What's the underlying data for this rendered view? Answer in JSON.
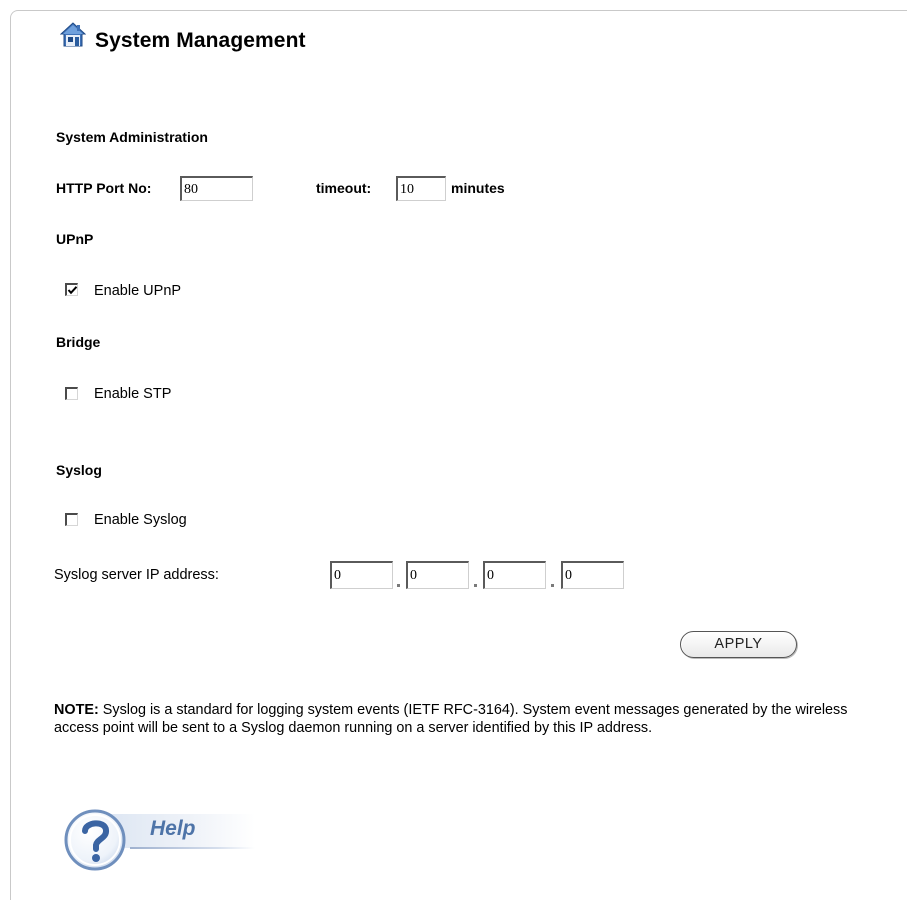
{
  "page": {
    "title": "System Management"
  },
  "sections": {
    "admin": "System Administration",
    "upnp": "UPnP",
    "bridge": "Bridge",
    "syslog": "Syslog"
  },
  "admin": {
    "http_port_label": "HTTP Port No:",
    "http_port_value": "80",
    "timeout_label": "timeout:",
    "timeout_value": "10",
    "timeout_unit": "minutes"
  },
  "upnp": {
    "enable_label": "Enable UPnP",
    "enabled": true
  },
  "bridge": {
    "stp_label": "Enable STP",
    "enabled": false
  },
  "syslog": {
    "enable_label": "Enable Syslog",
    "enabled": false,
    "server_ip_label": "Syslog server IP address:",
    "ip_octets": [
      "0",
      "0",
      "0",
      "0"
    ]
  },
  "actions": {
    "apply_label": "APPLY"
  },
  "note": {
    "prefix": "NOTE:",
    "text": " Syslog is a standard for logging system events (IETF RFC-3164). System event messages generated by the wireless access point will be sent to a Syslog daemon running on a server identified by this IP address."
  },
  "help": {
    "label": "Help"
  },
  "icons": {
    "title_icon": "home-icon",
    "help_icon": "question-mark-icon"
  },
  "colors": {
    "help_accent": "#4e74a8",
    "border": "#c9c9c9"
  }
}
